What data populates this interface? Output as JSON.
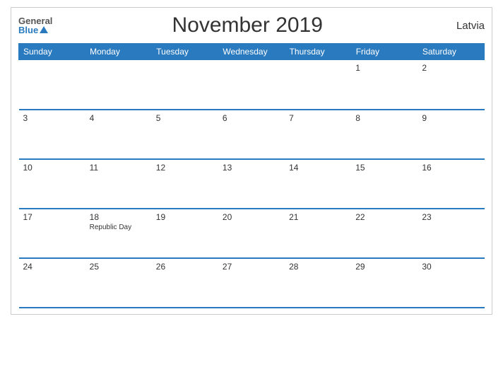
{
  "header": {
    "logo_general": "General",
    "logo_blue": "Blue",
    "title": "November 2019",
    "country": "Latvia"
  },
  "calendar": {
    "days_of_week": [
      "Sunday",
      "Monday",
      "Tuesday",
      "Wednesday",
      "Thursday",
      "Friday",
      "Saturday"
    ],
    "weeks": [
      [
        {
          "num": "",
          "holiday": ""
        },
        {
          "num": "",
          "holiday": ""
        },
        {
          "num": "",
          "holiday": ""
        },
        {
          "num": "",
          "holiday": ""
        },
        {
          "num": "",
          "holiday": ""
        },
        {
          "num": "1",
          "holiday": ""
        },
        {
          "num": "2",
          "holiday": ""
        }
      ],
      [
        {
          "num": "3",
          "holiday": ""
        },
        {
          "num": "4",
          "holiday": ""
        },
        {
          "num": "5",
          "holiday": ""
        },
        {
          "num": "6",
          "holiday": ""
        },
        {
          "num": "7",
          "holiday": ""
        },
        {
          "num": "8",
          "holiday": ""
        },
        {
          "num": "9",
          "holiday": ""
        }
      ],
      [
        {
          "num": "10",
          "holiday": ""
        },
        {
          "num": "11",
          "holiday": ""
        },
        {
          "num": "12",
          "holiday": ""
        },
        {
          "num": "13",
          "holiday": ""
        },
        {
          "num": "14",
          "holiday": ""
        },
        {
          "num": "15",
          "holiday": ""
        },
        {
          "num": "16",
          "holiday": ""
        }
      ],
      [
        {
          "num": "17",
          "holiday": ""
        },
        {
          "num": "18",
          "holiday": "Republic Day"
        },
        {
          "num": "19",
          "holiday": ""
        },
        {
          "num": "20",
          "holiday": ""
        },
        {
          "num": "21",
          "holiday": ""
        },
        {
          "num": "22",
          "holiday": ""
        },
        {
          "num": "23",
          "holiday": ""
        }
      ],
      [
        {
          "num": "24",
          "holiday": ""
        },
        {
          "num": "25",
          "holiday": ""
        },
        {
          "num": "26",
          "holiday": ""
        },
        {
          "num": "27",
          "holiday": ""
        },
        {
          "num": "28",
          "holiday": ""
        },
        {
          "num": "29",
          "holiday": ""
        },
        {
          "num": "30",
          "holiday": ""
        }
      ]
    ]
  }
}
